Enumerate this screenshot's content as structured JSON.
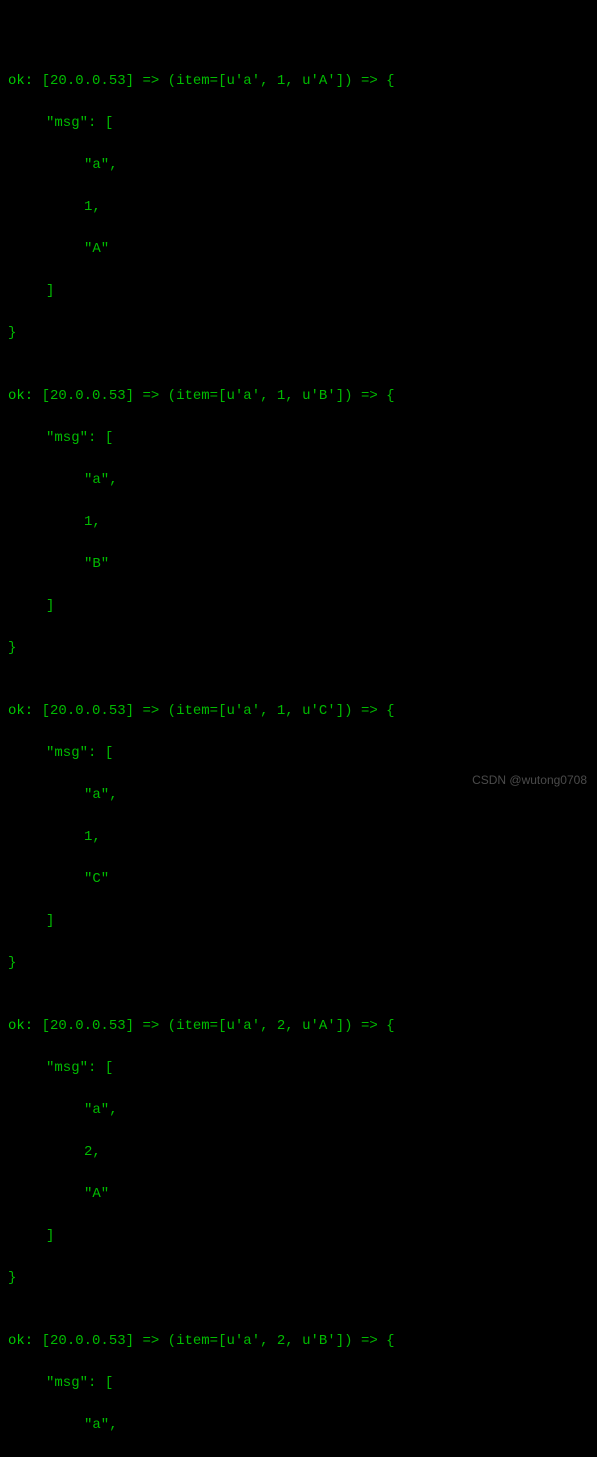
{
  "terminal": {
    "host": "[20.0.0.53]",
    "ok_label": "ok:",
    "arrow": "=>",
    "item_label": "item=",
    "msg_label": "\"msg\":",
    "entries": [
      {
        "item_repr": "[u'a', 1, u'A']",
        "msg_values": [
          "\"a\"",
          "1",
          "\"A\""
        ],
        "complete": true
      },
      {
        "item_repr": "[u'a', 1, u'B']",
        "msg_values": [
          "\"a\"",
          "1",
          "\"B\""
        ],
        "complete": true
      },
      {
        "item_repr": "[u'a', 1, u'C']",
        "msg_values": [
          "\"a\"",
          "1",
          "\"C\""
        ],
        "complete": true
      },
      {
        "item_repr": "[u'a', 2, u'A']",
        "msg_values": [
          "\"a\"",
          "2",
          "\"A\""
        ],
        "complete": true
      },
      {
        "item_repr": "[u'a', 2, u'B']",
        "msg_values": [
          "\"a\""
        ],
        "complete": false
      }
    ]
  },
  "watermark": "CSDN @wutong0708"
}
